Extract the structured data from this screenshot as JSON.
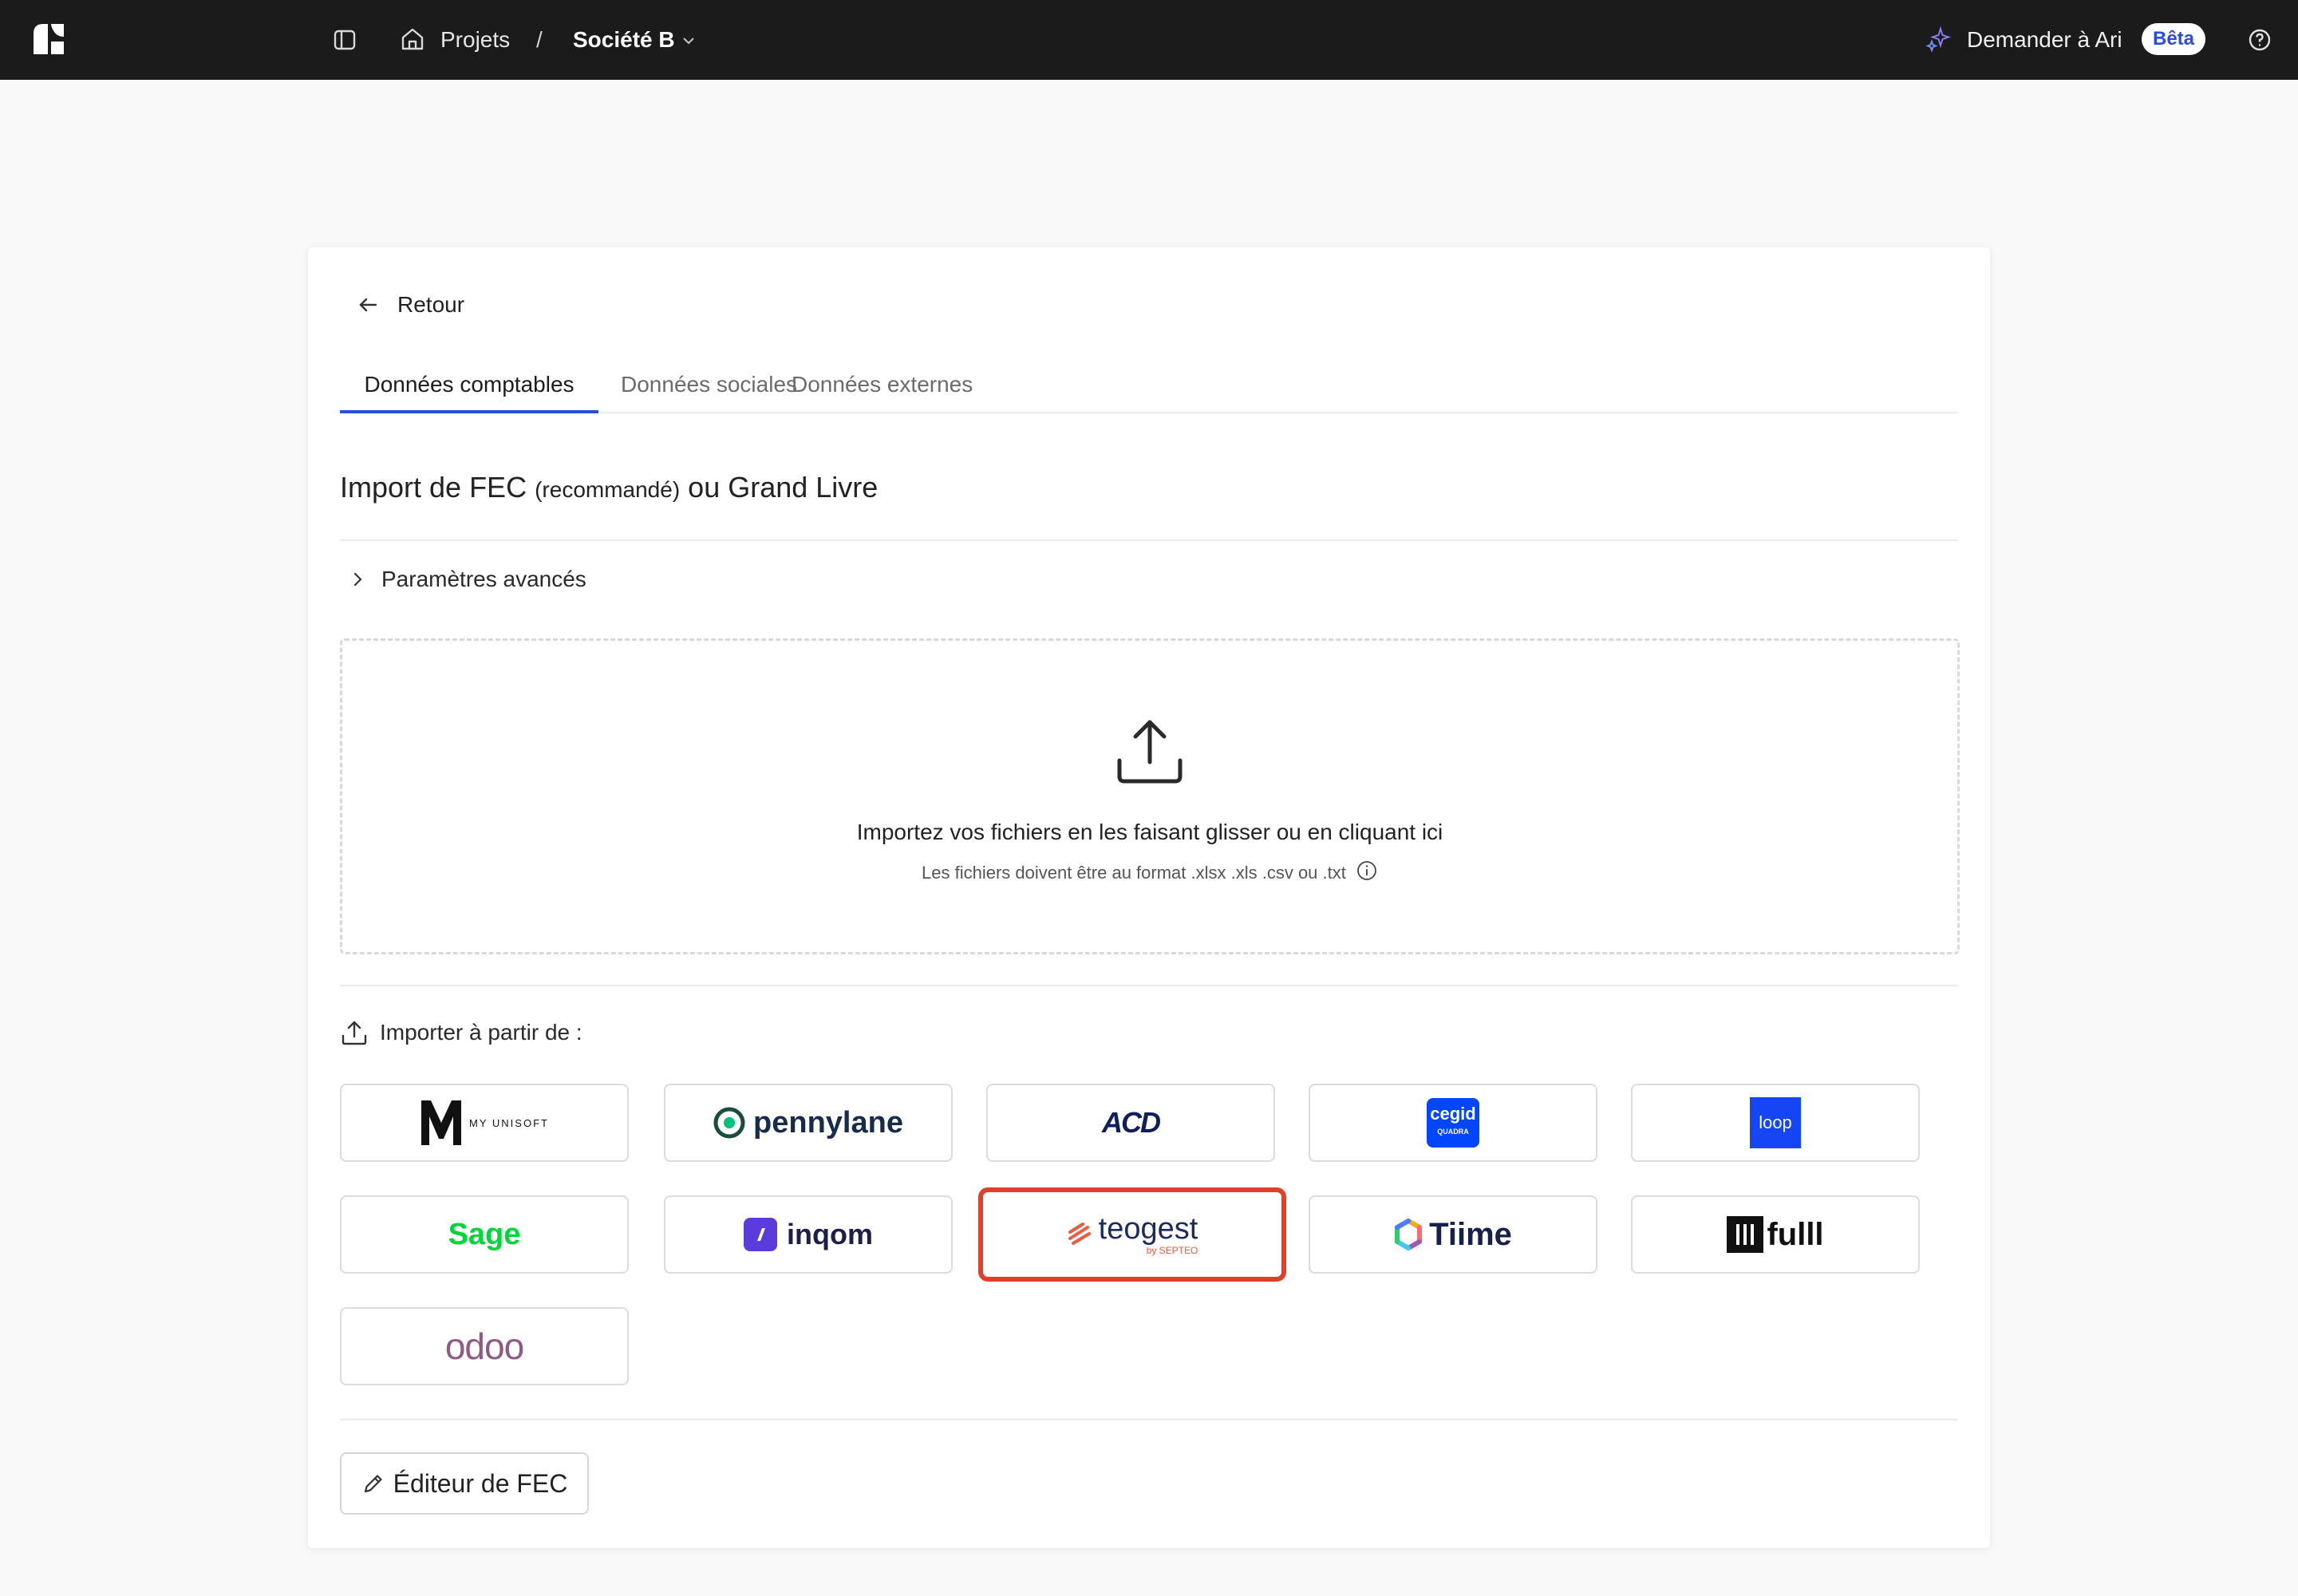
{
  "topbar": {
    "breadcrumb_projects": "Projets",
    "breadcrumb_separator": "/",
    "breadcrumb_company": "Société B",
    "ask_label": "Demander à Ari",
    "beta_badge": "Bêta",
    "icons": [
      "app-logo",
      "sidebar-toggle-icon",
      "home-icon",
      "chevron-down-icon",
      "sparkle-icon",
      "help-circle-icon"
    ]
  },
  "card": {
    "back_label": "Retour",
    "tabs": [
      {
        "label": "Données comptables",
        "active": true
      },
      {
        "label": "Données sociales",
        "active": false
      },
      {
        "label": "Données externes",
        "active": false
      }
    ],
    "title_part1": "Import de FEC",
    "title_part2": "(recommandé)",
    "title_part3": "ou Grand Livre",
    "advanced_label": "Paramètres avancés",
    "dropzone": {
      "main_text": "Importez vos fichiers en les faisant glisser ou en cliquant ici",
      "sub_text": "Les fichiers doivent être au format .xlsx .xls .csv ou .txt"
    },
    "import_from_label": "Importer à partir de :",
    "providers": [
      {
        "name": "MY UNISOFT",
        "logo_text": "MY UNISOFT"
      },
      {
        "name": "pennylane",
        "logo_text": "pennylane"
      },
      {
        "name": "ACD",
        "logo_text": "ACD"
      },
      {
        "name": "cegid",
        "logo_text": "cegid",
        "logo_subtext": "QUADRA"
      },
      {
        "name": "loop",
        "logo_text": "loop"
      },
      {
        "name": "Sage",
        "logo_text": "Sage"
      },
      {
        "name": "inqom",
        "logo_text": "inqom"
      },
      {
        "name": "teogest",
        "logo_text": "teogest",
        "logo_subtext": "by SEPTEO",
        "highlighted": true
      },
      {
        "name": "Tiime",
        "logo_text": "Tiime"
      },
      {
        "name": "fulll",
        "logo_text": "fulll"
      },
      {
        "name": "odoo",
        "logo_text": "odoo"
      }
    ],
    "fec_editor_label": "Éditeur de FEC"
  },
  "colors": {
    "topbar_bg": "#1b1b1b",
    "accent": "#2b4ce0",
    "highlight": "#e0402a",
    "sage_green": "#00d639",
    "odoo_purple": "#8f5a86",
    "teogest_orange": "#ee5a3d",
    "cegid_blue": "#0046ff"
  }
}
